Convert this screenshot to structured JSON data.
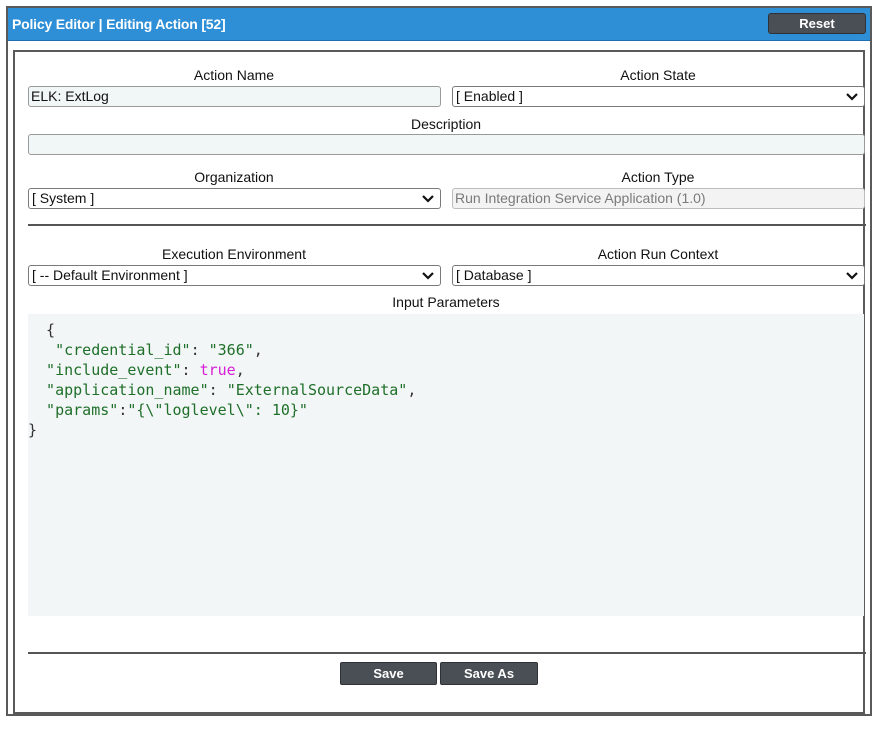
{
  "window": {
    "title": "Policy Editor | Editing Action [52]",
    "reset_label": "Reset"
  },
  "form": {
    "action_name": {
      "label": "Action Name",
      "value": "ELK:  ExtLog"
    },
    "action_state": {
      "label": "Action State",
      "value": "[ Enabled ]"
    },
    "description": {
      "label": "Description",
      "value": ""
    },
    "organization": {
      "label": "Organization",
      "value": "[ System ]"
    },
    "action_type": {
      "label": "Action Type",
      "value": "Run Integration Service Application (1.0)"
    },
    "execution_environment": {
      "label": "Execution Environment",
      "value": "[ -- Default Environment ]"
    },
    "action_run_context": {
      "label": "Action Run Context",
      "value": "[ Database ]"
    },
    "input_parameters": {
      "label": "Input Parameters",
      "lines": [
        {
          "text": "  {"
        },
        {
          "key": "   \"credential_id\"",
          "sep": ": ",
          "val": "\"366\"",
          "end": ","
        },
        {
          "key": "  \"include_event\"",
          "sep": ": ",
          "kw": "true",
          "end": ","
        },
        {
          "key": "  \"application_name\"",
          "sep": ": ",
          "val": "\"ExternalSourceData\"",
          "end": ","
        },
        {
          "key": "  \"params\"",
          "sep": ":",
          "val": "\"{\\\"loglevel\\\": 10}\"",
          "end": ""
        },
        {
          "text": "}"
        }
      ]
    }
  },
  "footer": {
    "save_label": "Save",
    "save_as_label": "Save As"
  },
  "icons": {
    "dropdown": "chevron-down-icon"
  },
  "colors": {
    "titlebar": "#2f8fd6",
    "button": "#4a4f55",
    "code_string": "#1f6f2a",
    "code_keyword": "#d61fd6"
  }
}
